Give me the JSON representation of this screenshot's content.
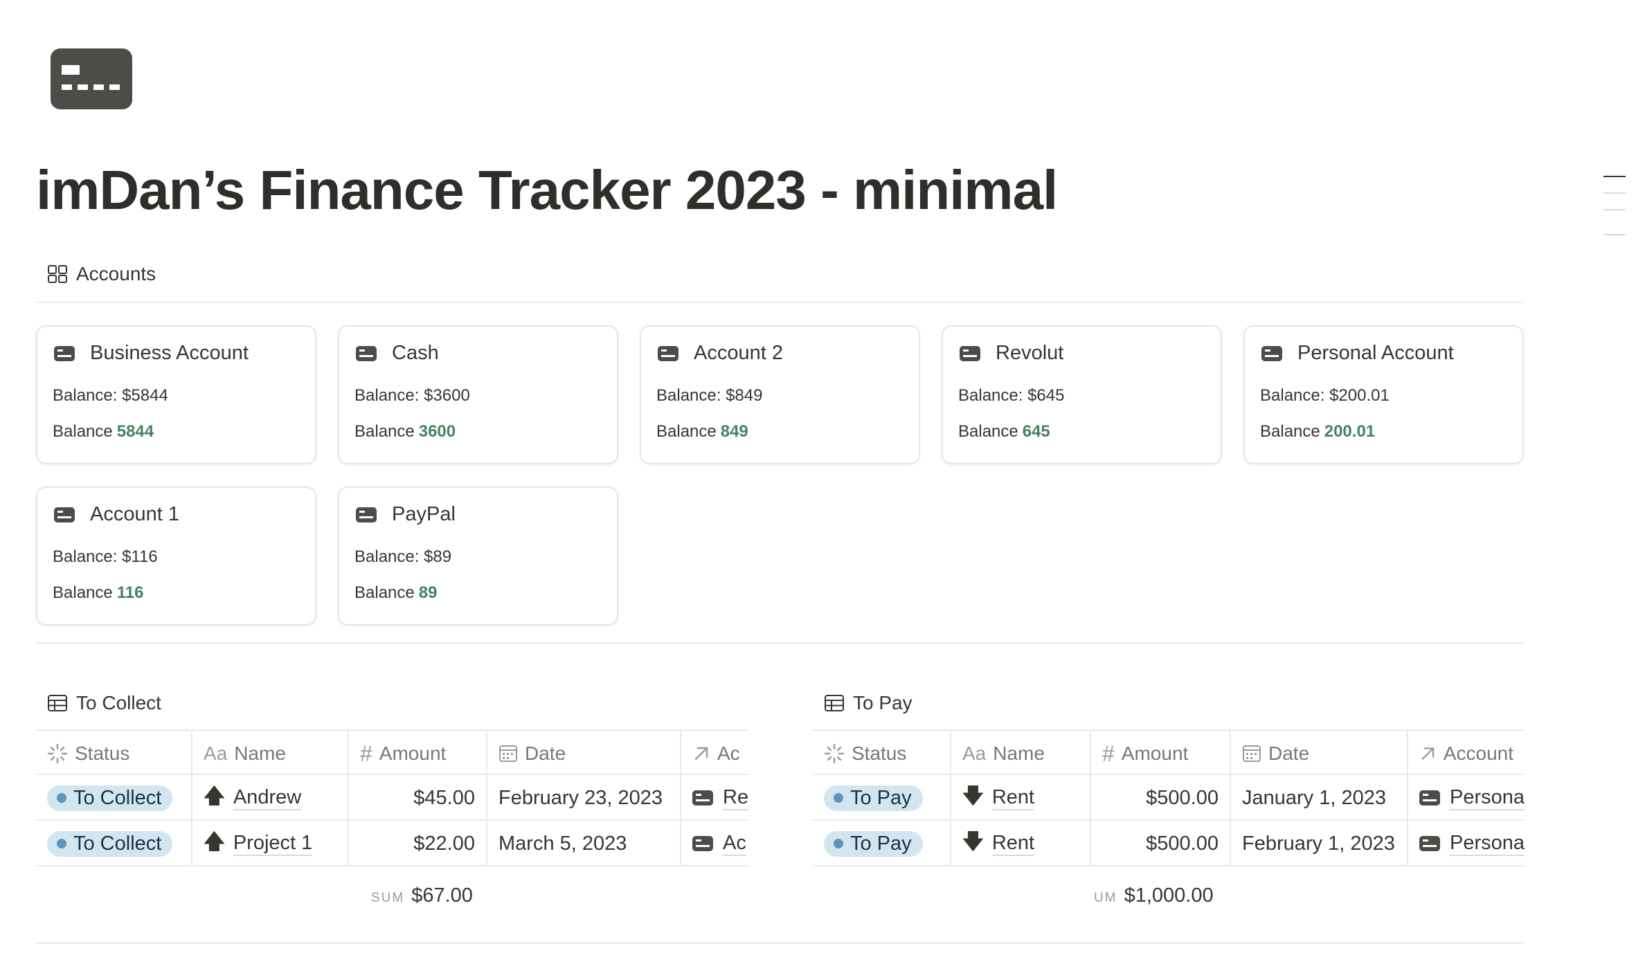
{
  "page": {
    "title": "imDan’s Finance Tracker 2023 - minimal",
    "icon": "credit-card-icon"
  },
  "accounts": {
    "header": "Accounts",
    "header_icon": "gallery-icon",
    "cards": [
      {
        "name": "Business Account",
        "balance_text": "Balance: $5844",
        "balance_label": "Balance",
        "balance_value": "5844"
      },
      {
        "name": "Cash",
        "balance_text": "Balance: $3600",
        "balance_label": "Balance",
        "balance_value": "3600"
      },
      {
        "name": "Account 2",
        "balance_text": "Balance: $849",
        "balance_label": "Balance",
        "balance_value": "849"
      },
      {
        "name": "Revolut",
        "balance_text": "Balance: $645",
        "balance_label": "Balance",
        "balance_value": "645"
      },
      {
        "name": "Personal Account",
        "balance_text": "Balance: $200.01",
        "balance_label": "Balance",
        "balance_value": "200.01"
      },
      {
        "name": "Account 1",
        "balance_text": "Balance: $116",
        "balance_label": "Balance",
        "balance_value": "116"
      },
      {
        "name": "PayPal",
        "balance_text": "Balance: $89",
        "balance_label": "Balance",
        "balance_value": "89"
      }
    ]
  },
  "to_collect": {
    "header": "To Collect",
    "header_icon": "table-icon",
    "columns": [
      "Status",
      "Name",
      "Amount",
      "Date",
      "Ac"
    ],
    "column_icons": [
      "status-icon",
      "text-icon",
      "hash-icon",
      "calendar-icon",
      "relation-arrow-icon"
    ],
    "name_prefix": "Aa",
    "rows": [
      {
        "status": "To Collect",
        "name": "Andrew",
        "amount": "$45.00",
        "date": "February 23, 2023",
        "account": "Re"
      },
      {
        "status": "To Collect",
        "name": "Project 1",
        "amount": "$22.00",
        "date": "March 5, 2023",
        "account": "Ac"
      }
    ],
    "sum_label": "SUM",
    "sum_value": "$67.00"
  },
  "to_pay": {
    "header": "To Pay",
    "header_icon": "table-icon",
    "columns": [
      "Status",
      "Name",
      "Amount",
      "Date",
      "Account"
    ],
    "column_icons": [
      "status-icon",
      "text-icon",
      "hash-icon",
      "calendar-icon",
      "relation-arrow-icon"
    ],
    "name_prefix": "Aa",
    "rows": [
      {
        "status": "To Pay",
        "name": "Rent",
        "amount": "$500.00",
        "date": "January 1, 2023",
        "account": "Persona"
      },
      {
        "status": "To Pay",
        "name": "Rent",
        "amount": "$500.00",
        "date": "February 1, 2023",
        "account": "Persona"
      }
    ],
    "sum_label": "UM",
    "sum_value": "$1,000.00"
  },
  "colors": {
    "text": "#37352f",
    "balance_green": "#448361",
    "status_pill_bg": "#d3e5ef",
    "status_dot": "#5b97bd",
    "border": "#e9e9e7",
    "icon_dark": "#4d4c48"
  }
}
